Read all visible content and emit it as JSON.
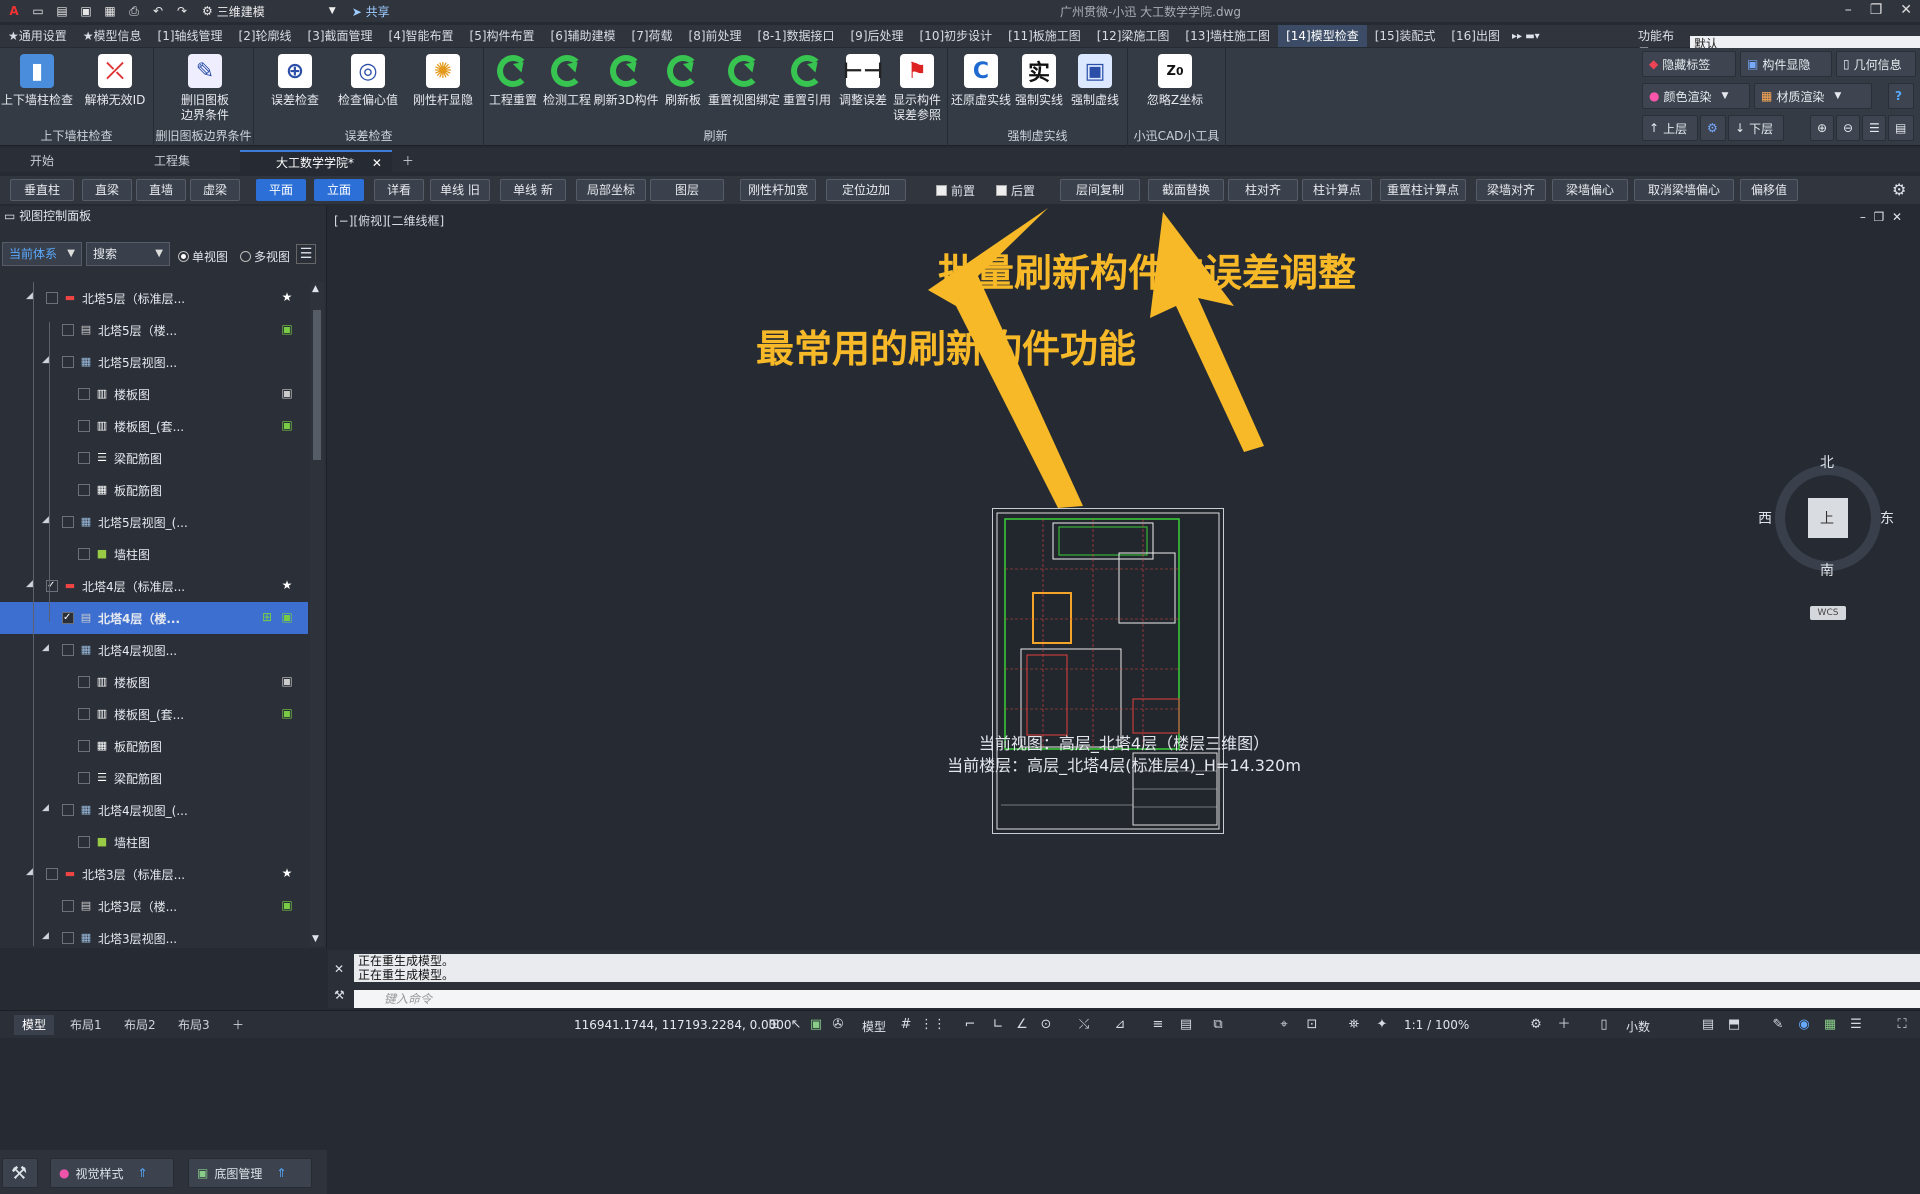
{
  "titlebar": {
    "workspace": "三维建模",
    "share": "共享",
    "app_title": "广州贯微-小迅     大工数学学院.dwg"
  },
  "menu_tabs": [
    "★通用设置",
    "★模型信息",
    "[1]轴线管理",
    "[2]轮廓线",
    "[3]截面管理",
    "[4]智能布置",
    "[5]构件布置",
    "[6]辅助建模",
    "[7]荷载",
    "[8]前处理",
    "[8-1]数据接口",
    "[9]后处理",
    "[10]初步设计",
    "[11]板施工图",
    "[12]梁施工图",
    "[13]墙柱施工图",
    "[14]模型检查",
    "[15]装配式",
    "[16]出图"
  ],
  "active_menu_tab": "[14]模型检查",
  "layout": {
    "label": "功能布局:",
    "value": "默认"
  },
  "ribbon": {
    "g1": {
      "btn1": "上下墙柱检查",
      "btn2": "解梯无效ID",
      "label": "上下墙柱检查"
    },
    "g2": {
      "btn1_l1": "删旧图板",
      "btn1_l2": "边界条件",
      "label": "删旧图板边界条件"
    },
    "g3": {
      "btn1": "误差检查",
      "btn2": "检查偏心值",
      "btn3": "刚性杆显隐",
      "label": "误差检查"
    },
    "g4": {
      "btn1": "工程重置",
      "btn2": "检测工程",
      "btn3": "刷新3D构件",
      "btn4": "刷新板",
      "btn5": "重置视图绑定",
      "btn6": "重置引用",
      "btn7": "调整误差",
      "btn8_l1": "显示构件",
      "btn8_l2": "误差参照",
      "label": "刷新"
    },
    "g5": {
      "btn1": "还原虚实线",
      "btn2": "强制实线",
      "btn3": "强制虚线",
      "label": "强制虚实线"
    },
    "g6": {
      "btn1": "忽略Z坐标",
      "label": "小迅CAD小工具"
    },
    "right": {
      "hide_tags": "隐藏标签",
      "comp_show": "构件显隐",
      "geom_info": "几何信息",
      "color_render": "颜色渲染",
      "mat_render": "材质渲染",
      "up_floor": "上层",
      "down_floor": "下层"
    }
  },
  "doc_tabs": {
    "start": "开始",
    "project": "工程集",
    "current": "大工数学学院*"
  },
  "command_buttons": [
    "垂直柱",
    "直梁",
    "直墙",
    "虚梁",
    "平面",
    "立面",
    "详看",
    "单线 旧",
    "单线 新",
    "局部坐标",
    "图层",
    "刚性杆加宽",
    "定位边加",
    "前置",
    "后置",
    "层间复制",
    "截面替换",
    "柱对齐",
    "柱计算点",
    "重置柱计算点",
    "梁墙对齐",
    "梁墙偏心",
    "取消梁墙偏心",
    "偏移值"
  ],
  "left_panel": {
    "title": "视图控制面板",
    "system_select": "当前体系",
    "search_select": "搜索",
    "single_view": "单视图",
    "multi_view": "多视图",
    "tree": [
      {
        "label": "北塔5层（标准层..."
      },
      {
        "label": "北塔5层（楼..."
      },
      {
        "label": "北塔5层视图..."
      },
      {
        "label": "楼板图"
      },
      {
        "label": "楼板图_(套..."
      },
      {
        "label": "梁配筋图"
      },
      {
        "label": "板配筋图"
      },
      {
        "label": "北塔5层视图_(..."
      },
      {
        "label": "墙柱图"
      },
      {
        "label": "北塔4层（标准层..."
      },
      {
        "label": "北塔4层（楼..."
      },
      {
        "label": "北塔4层视图..."
      },
      {
        "label": "楼板图"
      },
      {
        "label": "楼板图_(套..."
      },
      {
        "label": "板配筋图"
      },
      {
        "label": "梁配筋图"
      },
      {
        "label": "北塔4层视图_(..."
      },
      {
        "label": "墙柱图"
      },
      {
        "label": "北塔3层（标准层..."
      },
      {
        "label": "北塔3层（楼..."
      },
      {
        "label": "北塔3层视图..."
      }
    ],
    "bottom_style": "视觉样式",
    "bottom_base": "底图管理"
  },
  "canvas": {
    "view_label": "[−][俯视][二维线框]",
    "annotation_top": "批量刷新构件的误差调整",
    "annotation_bottom": "最常用的刷新构件功能",
    "current_view": "当前视图：高层_北塔4层（楼层三维图）",
    "current_floor": "当前楼层：高层_北塔4层(标准层4)_H=14.320m",
    "compass": {
      "n": "北",
      "s": "南",
      "e": "东",
      "w": "西",
      "top": "上",
      "wcs": "WCS"
    }
  },
  "command_line": {
    "msg1": "正在重生成模型。",
    "msg2": "正在重生成模型。",
    "placeholder": "键入命令"
  },
  "status_bar": {
    "tabs": [
      "模型",
      "布局1",
      "布局2",
      "布局3"
    ],
    "coords": "116941.1744, 117193.2284, 0.0000",
    "model": "模型",
    "scale": "1:1 / 100%",
    "units": "小数"
  },
  "colors": {
    "accent": "#2c6fd6",
    "annotation": "#f7b927",
    "refresh_green": "#38c451"
  }
}
